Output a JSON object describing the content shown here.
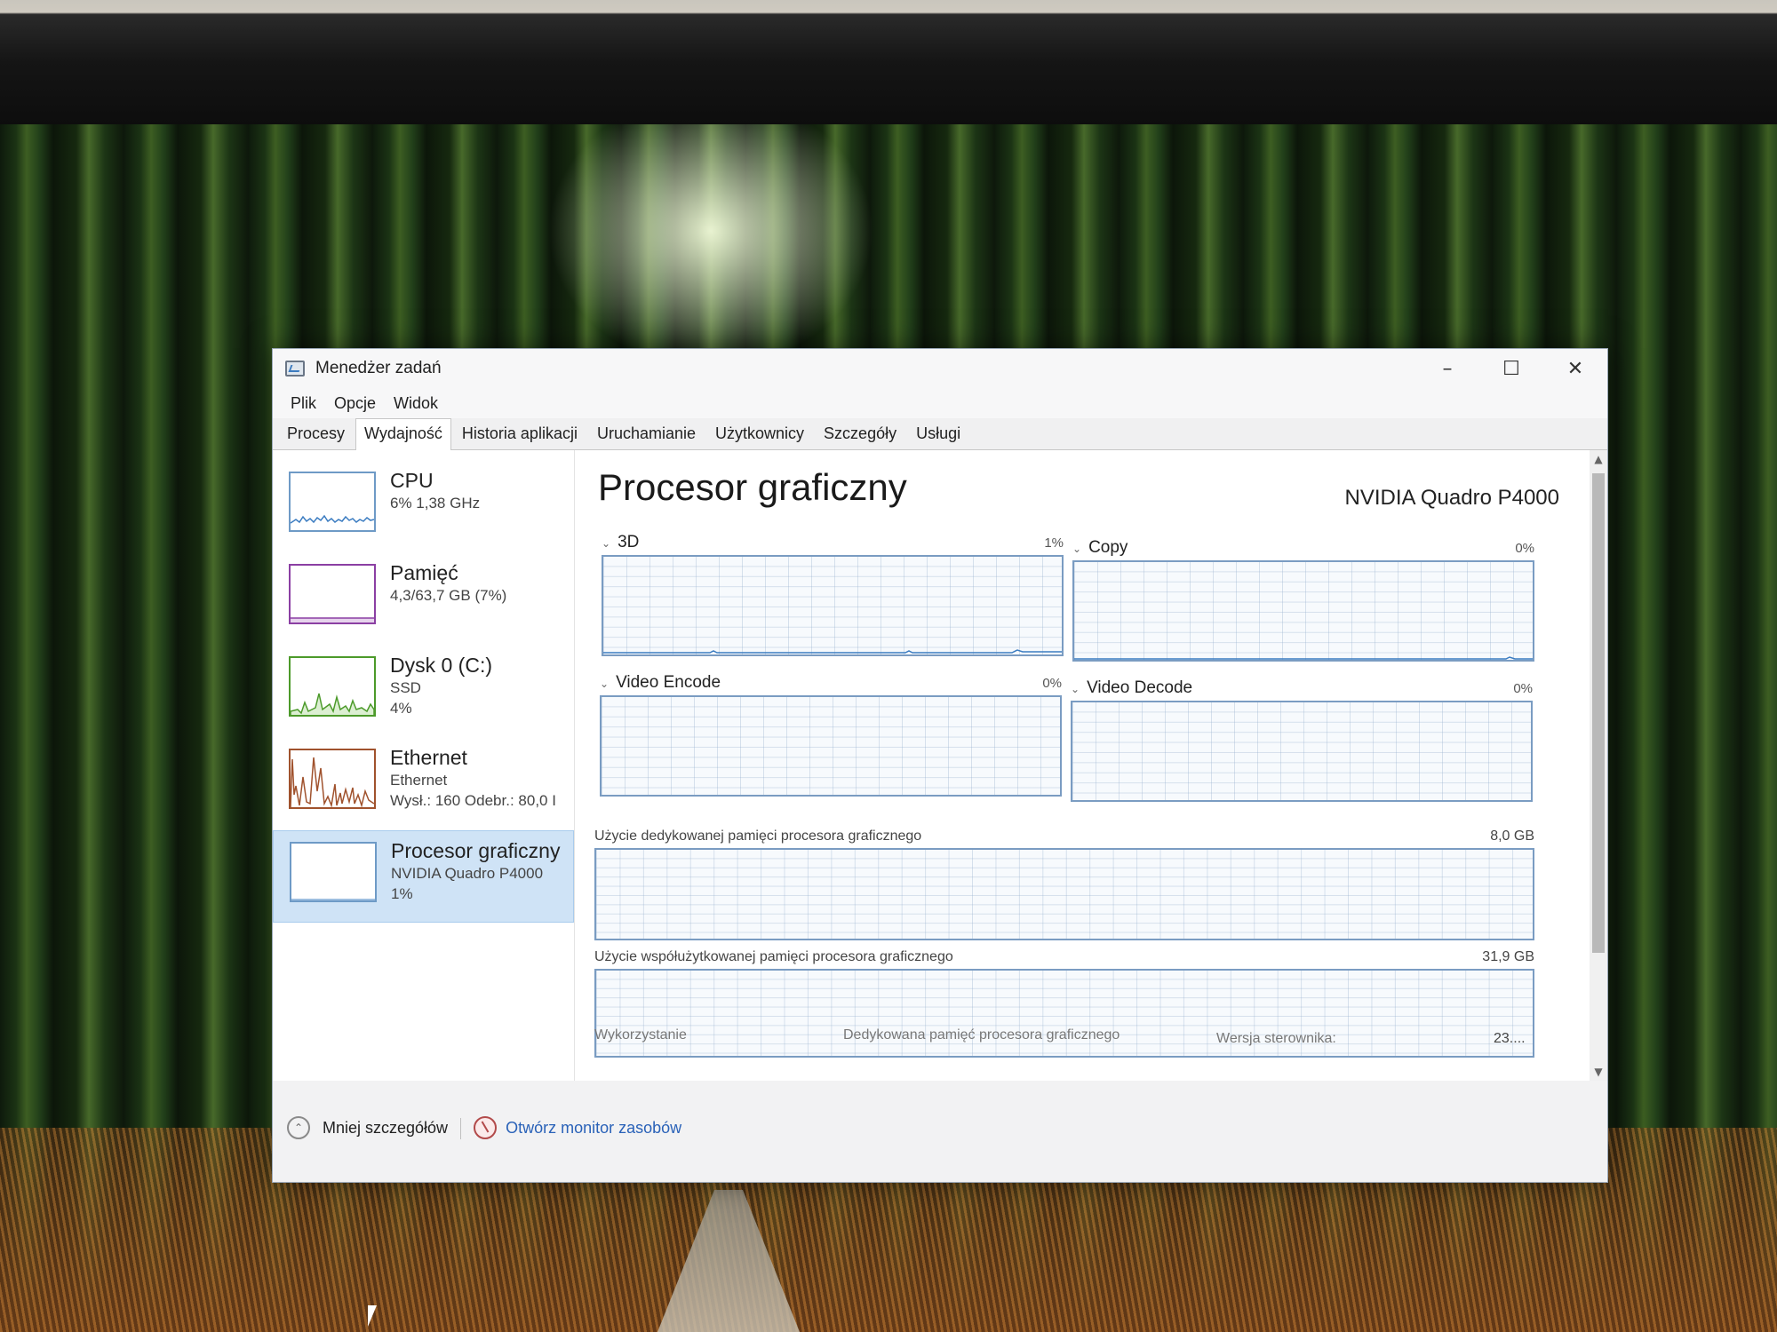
{
  "window": {
    "title": "Menedżer zadań",
    "controls": {
      "minimize": "–",
      "maximize": "☐",
      "close": "✕"
    }
  },
  "menu": [
    "Plik",
    "Opcje",
    "Widok"
  ],
  "tabs": [
    {
      "label": "Procesy",
      "active": false
    },
    {
      "label": "Wydajność",
      "active": true
    },
    {
      "label": "Historia aplikacji",
      "active": false
    },
    {
      "label": "Uruchamianie",
      "active": false
    },
    {
      "label": "Użytkownicy",
      "active": false
    },
    {
      "label": "Szczegóły",
      "active": false
    },
    {
      "label": "Usługi",
      "active": false
    }
  ],
  "sidebar": {
    "items": [
      {
        "name": "CPU",
        "line1": "6%  1,38 GHz",
        "line2": "",
        "selected": false
      },
      {
        "name": "Pamięć",
        "line1": "4,3/63,7 GB (7%)",
        "line2": "",
        "selected": false
      },
      {
        "name": "Dysk 0 (C:)",
        "line1": "SSD",
        "line2": "4%",
        "selected": false
      },
      {
        "name": "Ethernet",
        "line1": "Ethernet",
        "line2": "Wysł.: 160 Odebr.: 80,0 I",
        "selected": false
      },
      {
        "name": "Procesor graficzny",
        "line1": "NVIDIA Quadro P4000",
        "line2": "1%",
        "selected": true
      }
    ]
  },
  "main": {
    "title": "Procesor graficzny",
    "gpu_name": "NVIDIA Quadro P4000",
    "engines": [
      {
        "label": "3D",
        "percent": "1%"
      },
      {
        "label": "Copy",
        "percent": "0%"
      },
      {
        "label": "Video Encode",
        "percent": "0%"
      },
      {
        "label": "Video Decode",
        "percent": "0%"
      }
    ],
    "dedicated_memory": {
      "label": "Użycie dedykowanej pamięci procesora graficznego",
      "max": "8,0 GB"
    },
    "shared_memory": {
      "label": "Użycie współużytkowanej pamięci procesora graficznego",
      "max": "31,9 GB"
    },
    "stats": {
      "utilization_label": "Wykorzystanie",
      "dedicated_label": "Dedykowana pamięć procesora graficznego",
      "driver_label": "Wersja sterownika:",
      "driver_value": "23...."
    }
  },
  "footer": {
    "fewer_details": "Mniej szczegółów",
    "resource_monitor": "Otwórz monitor zasobów"
  },
  "colors": {
    "accent_blue": "#7a9cc2",
    "selected_bg": "#cfe3f6",
    "cpu_line": "#3b7cc1",
    "memory_line": "#8b3fa3",
    "disk_line": "#4c9a2a",
    "ethernet_line": "#a0522d",
    "link": "#2a62b8"
  },
  "icons": {
    "app": "task-manager-icon",
    "fewer_details": "chevron-up-icon",
    "resource_monitor": "resource-monitor-icon"
  }
}
